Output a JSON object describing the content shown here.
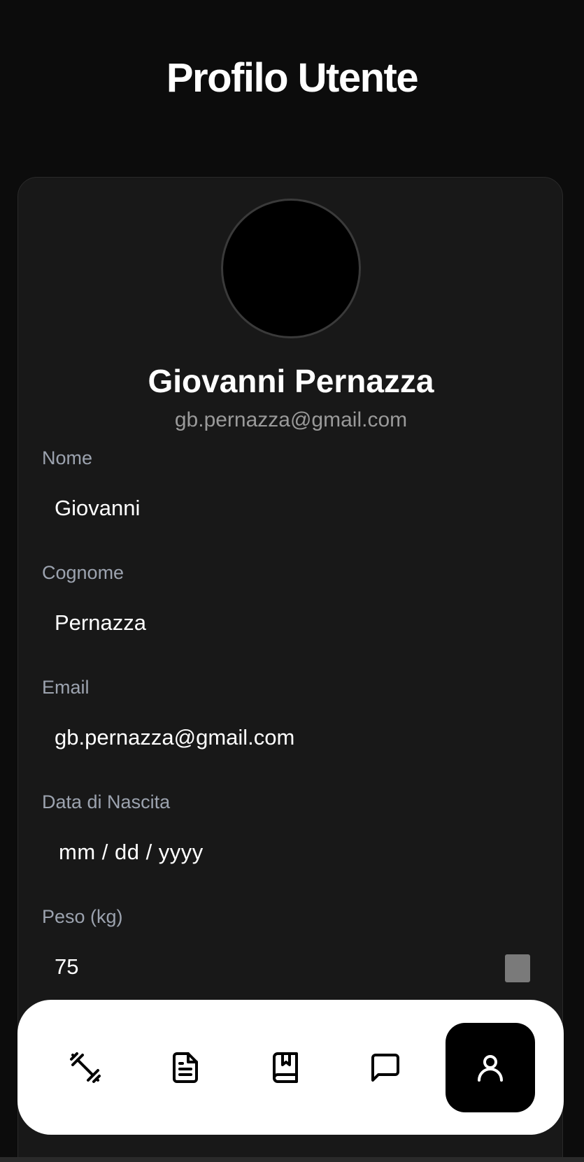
{
  "header": {
    "title": "Profilo Utente"
  },
  "profile": {
    "name": "Giovanni Pernazza",
    "email": "gb.pernazza@gmail.com"
  },
  "form": {
    "nome": {
      "label": "Nome",
      "value": "Giovanni"
    },
    "cognome": {
      "label": "Cognome",
      "value": "Pernazza"
    },
    "email": {
      "label": "Email",
      "value": "gb.pernazza@gmail.com"
    },
    "data_nascita": {
      "label": "Data di Nascita",
      "placeholder": "mm / dd / yyyy"
    },
    "peso": {
      "label": "Peso (kg)",
      "value": "75"
    }
  },
  "nav": {
    "items": [
      {
        "icon": "dumbbell-icon",
        "active": false
      },
      {
        "icon": "document-icon",
        "active": false
      },
      {
        "icon": "book-icon",
        "active": false
      },
      {
        "icon": "chat-icon",
        "active": false
      },
      {
        "icon": "user-icon",
        "active": true
      }
    ]
  },
  "colors": {
    "background": "#0c0c0c",
    "card": "#181818",
    "label": "#9ca3af",
    "nav_bg": "#ffffff",
    "nav_active": "#000000"
  }
}
